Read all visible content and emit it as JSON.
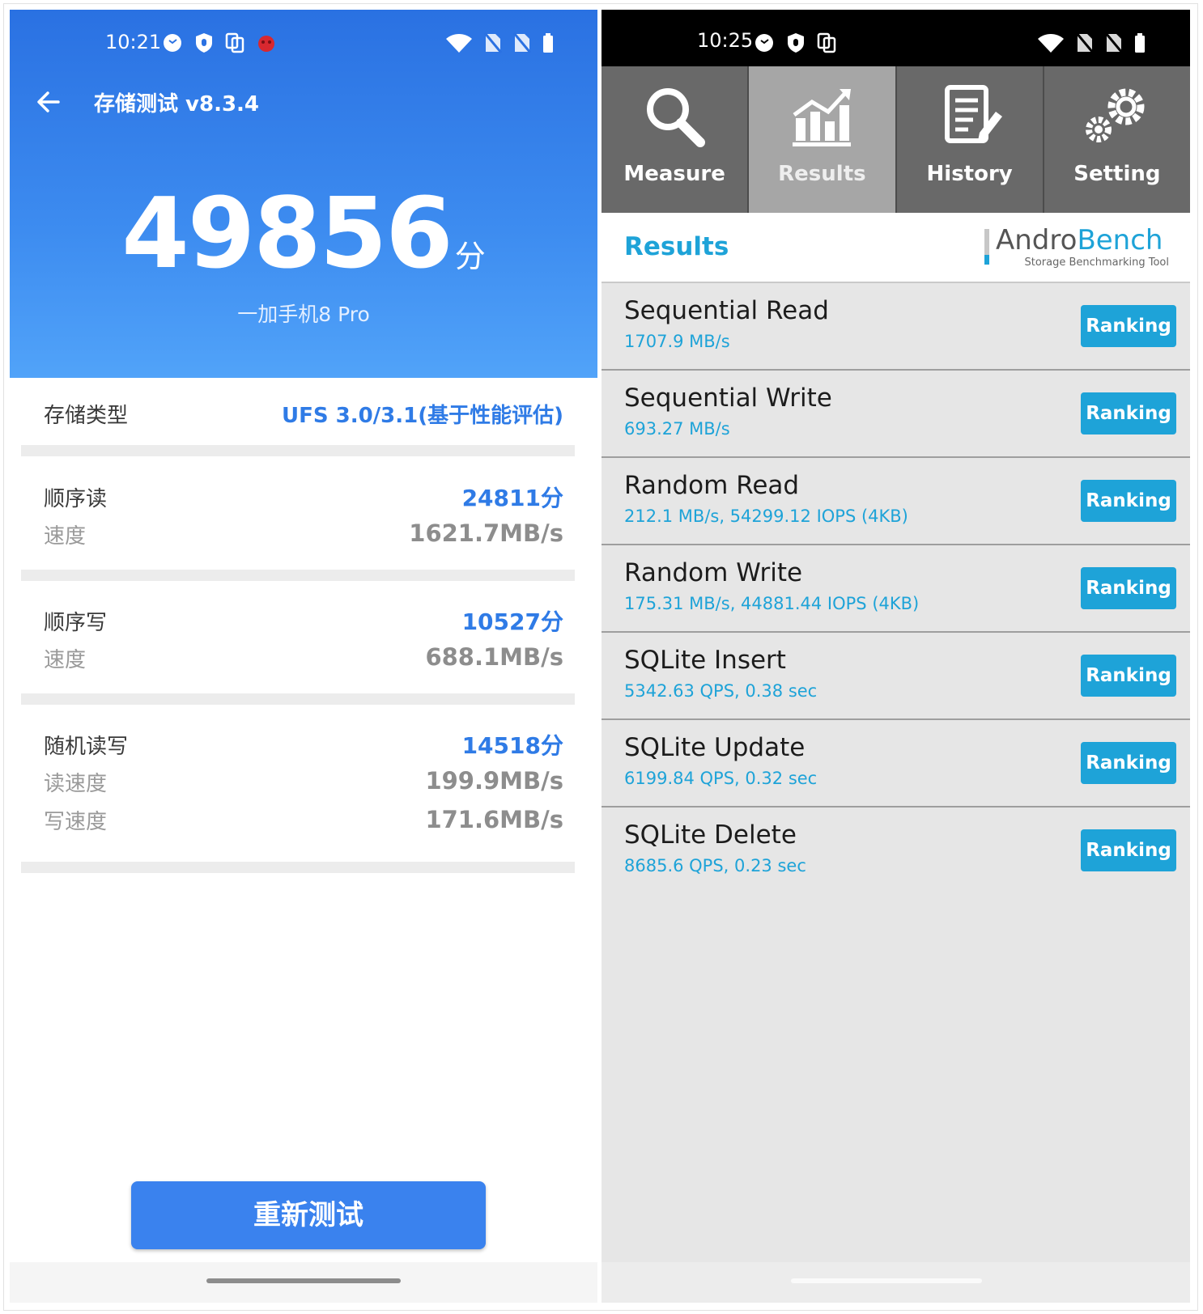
{
  "left": {
    "status": {
      "time": "10:21"
    },
    "header": {
      "title": "存储测试 v8.3.4"
    },
    "score": {
      "value": "49856",
      "unit": "分",
      "device": "一加手机8 Pro"
    },
    "storage_type": {
      "label": "存储类型",
      "value": "UFS 3.0/3.1(基于性能评估)"
    },
    "sections": [
      {
        "label": "顺序读",
        "score": "24811分",
        "rows": [
          {
            "label": "速度",
            "value": "1621.7MB/s"
          }
        ]
      },
      {
        "label": "顺序写",
        "score": "10527分",
        "rows": [
          {
            "label": "速度",
            "value": "688.1MB/s"
          }
        ]
      },
      {
        "label": "随机读写",
        "score": "14518分",
        "rows": [
          {
            "label": "读速度",
            "value": "199.9MB/s"
          },
          {
            "label": "写速度",
            "value": "171.6MB/s"
          }
        ]
      }
    ],
    "retest_label": "重新测试",
    "colors": {
      "header_top": "#2a71e2",
      "header_bottom": "#51a3f9",
      "accent": "#2f7be6"
    }
  },
  "right": {
    "status": {
      "time": "10:25"
    },
    "tabs": [
      {
        "label": "Measure",
        "icon": "magnifier-icon",
        "active": false
      },
      {
        "label": "Results",
        "icon": "chart-icon",
        "active": true
      },
      {
        "label": "History",
        "icon": "document-icon",
        "active": false
      },
      {
        "label": "Setting",
        "icon": "gears-icon",
        "active": false
      }
    ],
    "results_title": "Results",
    "logo": {
      "part1": "Andro",
      "part2": "Bench",
      "tagline": "Storage Benchmarking Tool"
    },
    "results": [
      {
        "name": "Sequential Read",
        "value": "1707.9 MB/s",
        "button": "Ranking"
      },
      {
        "name": "Sequential Write",
        "value": "693.27 MB/s",
        "button": "Ranking"
      },
      {
        "name": "Random Read",
        "value": "212.1 MB/s, 54299.12 IOPS (4KB)",
        "button": "Ranking"
      },
      {
        "name": "Random Write",
        "value": "175.31 MB/s, 44881.44 IOPS (4KB)",
        "button": "Ranking"
      },
      {
        "name": "SQLite Insert",
        "value": "5342.63 QPS, 0.38 sec",
        "button": "Ranking"
      },
      {
        "name": "SQLite Update",
        "value": "6199.84 QPS, 0.32 sec",
        "button": "Ranking"
      },
      {
        "name": "SQLite Delete",
        "value": "8685.6 QPS, 0.23 sec",
        "button": "Ranking"
      }
    ],
    "colors": {
      "accent": "#1ea3d8",
      "tab_active": "#a6a6a6",
      "tab": "#696969"
    }
  }
}
